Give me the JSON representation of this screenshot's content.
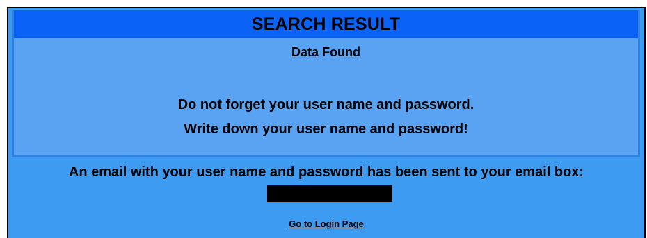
{
  "search_result": {
    "title": "SEARCH RESULT",
    "status": "Data Found",
    "message_line_1": "Do not forget your user name and password.",
    "message_line_2": "Write down your user name and password!"
  },
  "email_notice": {
    "text": "An email with your user name and password has been sent to your email box:"
  },
  "links": {
    "login": "Go to Login Page"
  },
  "colors": {
    "background": "#3d9cf2",
    "panel": "#5aa3f3",
    "title_bar": "#0b62f6"
  }
}
